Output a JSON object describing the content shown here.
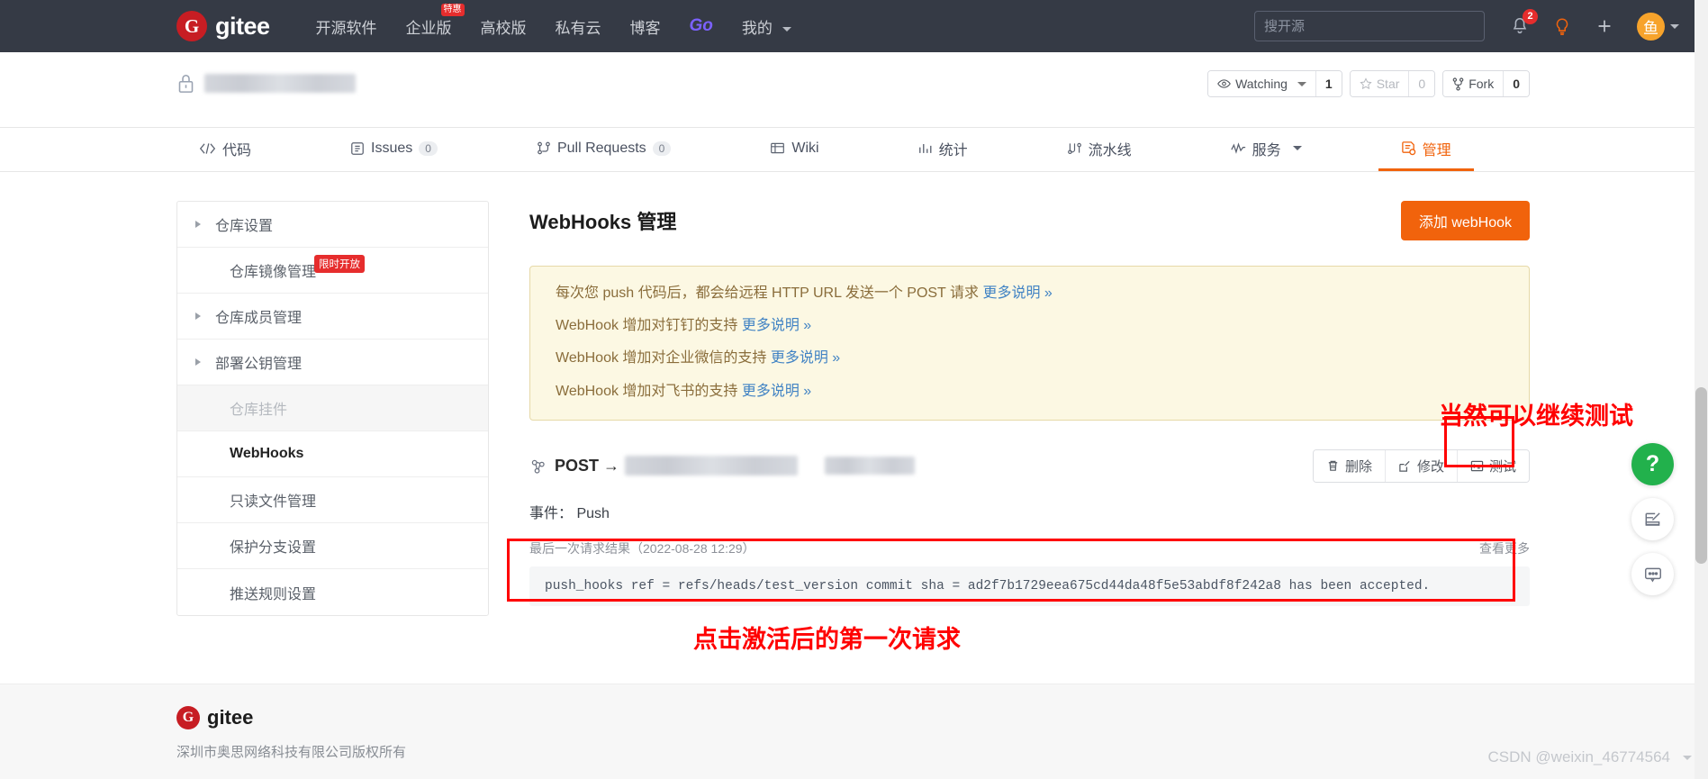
{
  "topnav": {
    "brand": "gitee",
    "brand_mark": "G",
    "links": [
      {
        "label": "开源软件",
        "badge": null
      },
      {
        "label": "企业版",
        "badge": "特惠"
      },
      {
        "label": "高校版",
        "badge": null
      },
      {
        "label": "私有云",
        "badge": null
      },
      {
        "label": "博客",
        "badge": null
      },
      {
        "label": "Go",
        "badge": null
      },
      {
        "label": "我的",
        "badge": null
      }
    ],
    "search_placeholder": "搜开源",
    "notification_count": "2",
    "avatar_text": "鱼"
  },
  "repo": {
    "watching_label": "Watching",
    "watching_count": "1",
    "star_label": "Star",
    "star_count": "0",
    "fork_label": "Fork",
    "fork_count": "0"
  },
  "tabs": [
    {
      "label": "代码",
      "count": null,
      "active": false
    },
    {
      "label": "Issues",
      "count": "0",
      "active": false
    },
    {
      "label": "Pull Requests",
      "count": "0",
      "active": false
    },
    {
      "label": "Wiki",
      "count": null,
      "active": false
    },
    {
      "label": "统计",
      "count": null,
      "active": false
    },
    {
      "label": "流水线",
      "count": null,
      "active": false
    },
    {
      "label": "服务",
      "count": null,
      "active": false
    },
    {
      "label": "管理",
      "count": null,
      "active": true
    }
  ],
  "sidebar": {
    "items": [
      {
        "label": "仓库设置",
        "expandable": true,
        "badge": null,
        "state": "normal"
      },
      {
        "label": "仓库镜像管理",
        "expandable": false,
        "badge": "限时开放",
        "state": "normal"
      },
      {
        "label": "仓库成员管理",
        "expandable": true,
        "badge": null,
        "state": "normal"
      },
      {
        "label": "部署公钥管理",
        "expandable": true,
        "badge": null,
        "state": "normal"
      },
      {
        "label": "仓库挂件",
        "expandable": false,
        "badge": null,
        "state": "disabled"
      },
      {
        "label": "WebHooks",
        "expandable": false,
        "badge": null,
        "state": "active"
      },
      {
        "label": "只读文件管理",
        "expandable": false,
        "badge": null,
        "state": "normal"
      },
      {
        "label": "保护分支设置",
        "expandable": false,
        "badge": null,
        "state": "normal"
      },
      {
        "label": "推送规则设置",
        "expandable": false,
        "badge": null,
        "state": "normal"
      }
    ]
  },
  "main": {
    "title": "WebHooks 管理",
    "add_button": "添加 webHook",
    "notice_lines": [
      {
        "text": "每次您 push 代码后，都会给远程 HTTP URL 发送一个 POST 请求 ",
        "link": "更多说明 »"
      },
      {
        "text": "WebHook 增加对钉钉的支持 ",
        "link": "更多说明 »"
      },
      {
        "text": "WebHook 增加对企业微信的支持 ",
        "link": "更多说明 »"
      },
      {
        "text": "WebHook 增加对飞书的支持 ",
        "link": "更多说明 »"
      }
    ],
    "hook_method": "POST →",
    "hook_actions": [
      {
        "label": "删除",
        "icon": "trash-icon"
      },
      {
        "label": "修改",
        "icon": "edit-icon"
      },
      {
        "label": "测试",
        "icon": "terminal-icon"
      }
    ],
    "event_label": "事件：",
    "event_value": "Push",
    "result_label": "最后一次请求结果（2022-08-28 12:29）",
    "view_more": "查看更多",
    "log_text": "push_hooks ref = refs/heads/test_version commit sha = ad2f7b1729eea675cd44da48f5e53abdf8f242a8 has been accepted."
  },
  "annotations": {
    "top_right": "当然可以继续测试",
    "bottom": "点击激活后的第一次请求",
    "color": "#ff0000"
  },
  "floaters": [
    {
      "name": "help-icon",
      "glyph": "?"
    },
    {
      "name": "feedback-edit-icon",
      "glyph": ""
    },
    {
      "name": "chat-icon",
      "glyph": ""
    }
  ],
  "footer": {
    "brand": "gitee",
    "brand_mark": "G",
    "copyright": "深圳市奥思网络科技有限公司版权所有"
  },
  "watermark": "CSDN @weixin_46774564"
}
